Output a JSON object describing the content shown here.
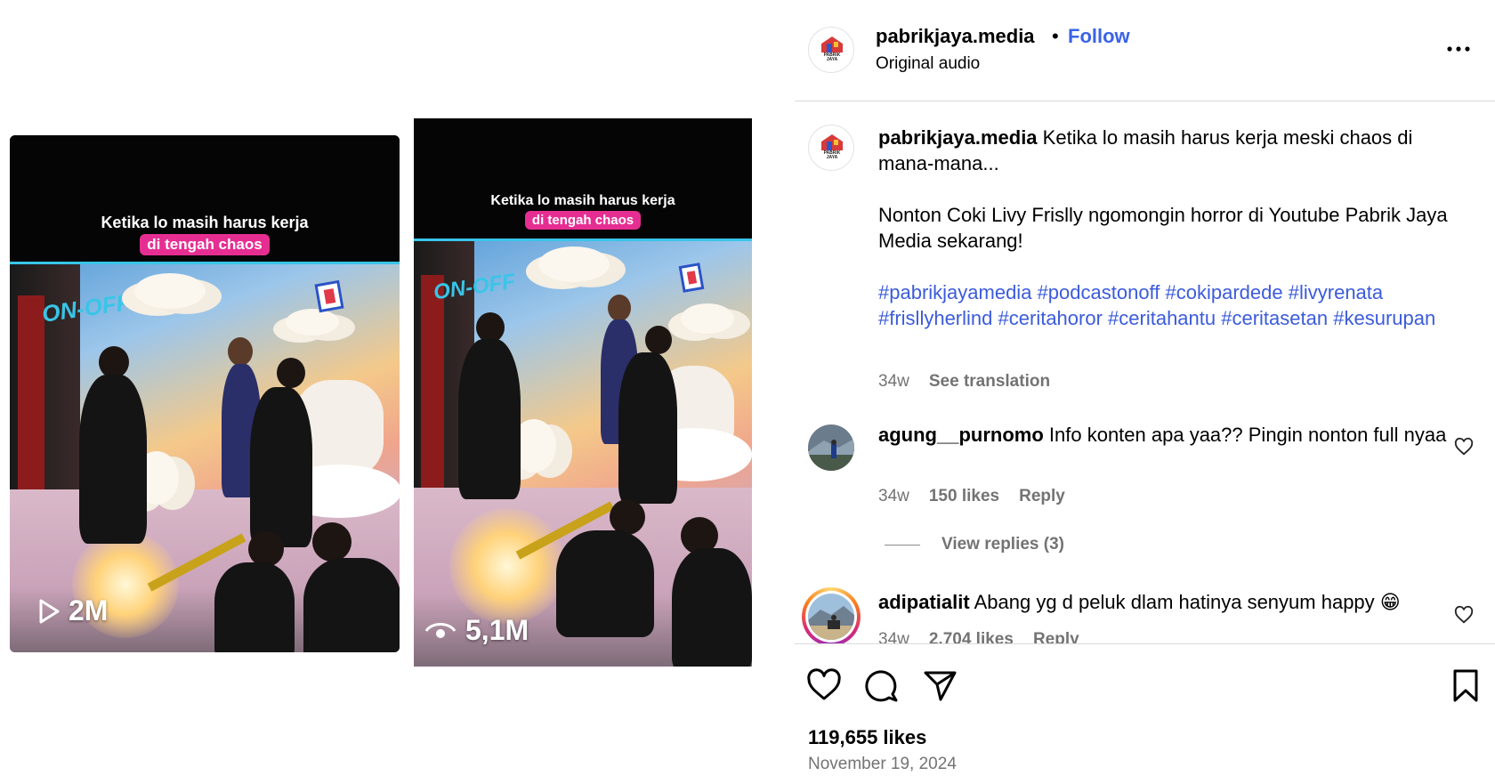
{
  "clips": [
    {
      "caption_top": "Ketika lo masih harus kerja",
      "caption_pill": "di tengah chaos",
      "stat_icon": "play-icon",
      "stat": "2M",
      "watermark": "ON-OFF"
    },
    {
      "caption_top": "Ketika lo masih harus kerja",
      "caption_pill": "di tengah chaos",
      "stat_icon": "eye-icon",
      "stat": "5,1M",
      "watermark": "ON-OFF"
    }
  ],
  "header": {
    "username": "pabrikjaya.media",
    "separator": "•",
    "follow_label": "Follow",
    "subtitle": "Original audio",
    "more_icon": "more-horizontal-icon"
  },
  "avatar_logo_text": "PABRIK JAYA",
  "caption": {
    "username": "pabrikjaya.media",
    "text1": "Ketika lo masih harus kerja meski chaos di mana-mana...",
    "text2": "Nonton Coki Livy Frislly ngomongin horror di Youtube Pabrik Jaya Media sekarang!",
    "hashtags": [
      "#pabrikjayamedia",
      "#podcastonoff",
      "#cokipardede",
      "#livyrenata",
      "#frisllyherlind",
      "#ceritahoror",
      "#ceritahantu",
      "#ceritasetan",
      "#kesurupan"
    ],
    "time": "34w",
    "see_translation": "See translation"
  },
  "comments": [
    {
      "username": "agung__purnomo",
      "text": "Info konten apa yaa?? Pingin nonton full nyaa",
      "time": "34w",
      "likes": "150 likes",
      "reply": "Reply",
      "view_replies": "View replies (3)"
    },
    {
      "username": "adipatialit",
      "text": "Abang yg d peluk dlam hatinya senyum happy 😁",
      "time": "34w",
      "likes": "2,704 likes",
      "reply": "Reply"
    }
  ],
  "footer": {
    "likes": "119,655 likes",
    "date": "November 19, 2024"
  },
  "colors": {
    "follow": "#3a63e8",
    "hashtag": "#3b5bdb",
    "pill": "#e62e92",
    "muted": "#737373"
  }
}
